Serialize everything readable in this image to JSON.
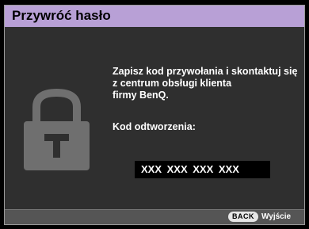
{
  "dialog": {
    "title": "Przywróć hasło",
    "message_lines": [
      "Zapisz kod przywołania i skontaktuj się",
      "z centrum obsługi klienta",
      "firmy BenQ."
    ],
    "code_label": "Kod odtworzenia:",
    "code_value": "XXX XXX XXX XXX",
    "icon": "lock-icon"
  },
  "footer": {
    "back_key": "BACK",
    "exit_label": "Wyjście"
  },
  "colors": {
    "title_bar": "#b8a0d6",
    "panel": "#2f2f2f",
    "lock": "#6f6f6f",
    "footer": "#555555"
  }
}
